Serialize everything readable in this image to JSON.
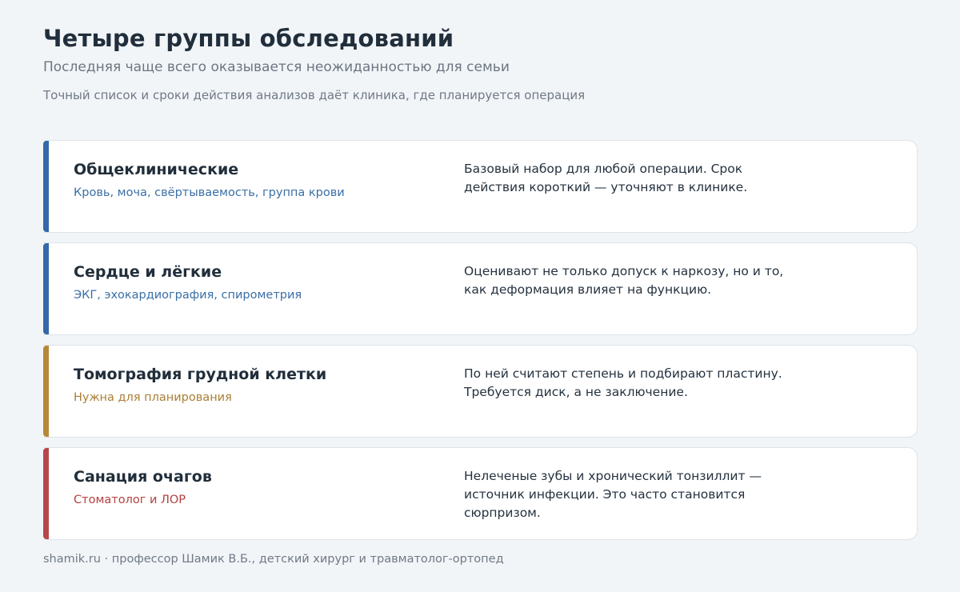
{
  "header": {
    "title": "Четыре группы обследований",
    "subtitle": "Последняя чаще всего оказывается неожиданностью для семьи",
    "note": "Точный список и сроки действия анализов даёт клиника, где планируется операция"
  },
  "cards": [
    {
      "name": "Общеклинические",
      "tags": "Кровь, моча, свёртываемость, группа крови",
      "description": "Базовый набор для любой операции. Срок действия короткий — уточняют в клинике.",
      "accent_color": "#3468a8",
      "tag_color": "#3b6fa6"
    },
    {
      "name": "Сердце и лёгкие",
      "tags": "ЭКГ, эхокардиография, спирометрия",
      "description": "Оценивают не только допуск к наркозу, но и то, как деформация влияет на функцию.",
      "accent_color": "#3468a8",
      "tag_color": "#3b6fa6"
    },
    {
      "name": "Томография грудной клетки",
      "tags": "Нужна для планирования",
      "description": "По ней считают степень и подбирают пластину. Требуется диск, а не заключение.",
      "accent_color": "#b5883a",
      "tag_color": "#a97f36"
    },
    {
      "name": "Санация очагов",
      "tags": "Стоматолог и ЛОР",
      "description": "Нелеченые зубы и хронический тонзиллит — источник инфекции. Это часто становится сюрпризом.",
      "accent_color": "#b5474a",
      "tag_color": "#b3403f"
    }
  ],
  "footer": {
    "text": "shamik.ru · профессор Шамик В.Б., детский хирург и травматолог-ортопед"
  }
}
